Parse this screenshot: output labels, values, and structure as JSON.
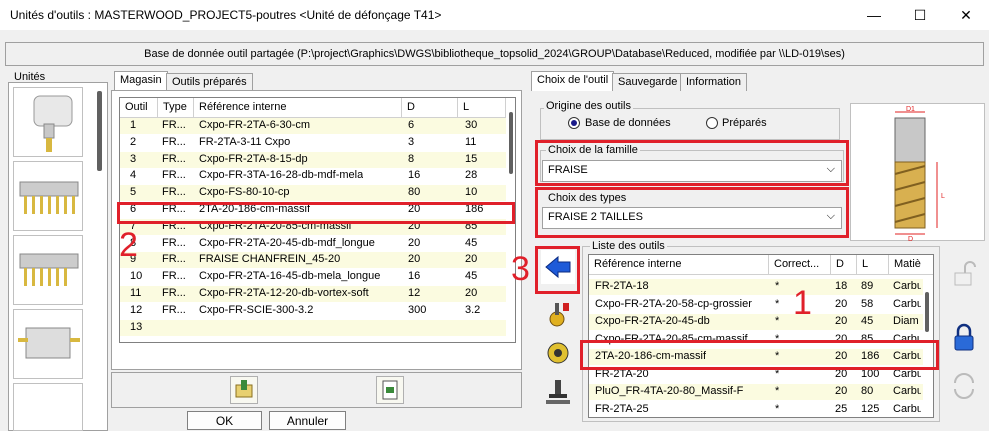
{
  "window": {
    "title": "Unités d'outils : MASTERWOOD_PROJECT5-poutres <Unité de défonçage  T41>",
    "minimize": "—",
    "maximize": "☐",
    "close": "✕"
  },
  "db_path": "Base de donnée outil partagée (P:\\project\\Graphics\\DWGS\\bibliotheque_topsolid_2024\\GROUP\\Database\\Reduced, modifiée par \\\\LD-019\\ses)",
  "units": {
    "label": "Unités",
    "items": [
      "unit-1",
      "unit-2",
      "unit-3",
      "unit-4",
      "unit-5"
    ]
  },
  "left_tabs": {
    "magasin": "Magasin",
    "prepared": "Outils préparés"
  },
  "tool_table": {
    "columns": [
      "Outil",
      "Type",
      "Référence interne",
      "D",
      "L"
    ],
    "rows": [
      {
        "outil": "1",
        "type": "FR...",
        "ref": "Cxpo-FR-2TA-6-30-cm",
        "d": "6",
        "l": "30"
      },
      {
        "outil": "2",
        "type": "FR...",
        "ref": "FR-2TA-3-11 Cxpo",
        "d": "3",
        "l": "11"
      },
      {
        "outil": "3",
        "type": "FR...",
        "ref": "Cxpo-FR-2TA-8-15-dp",
        "d": "8",
        "l": "15"
      },
      {
        "outil": "4",
        "type": "FR...",
        "ref": "Cxpo-FR-3TA-16-28-db-mdf-mela",
        "d": "16",
        "l": "28"
      },
      {
        "outil": "5",
        "type": "FR...",
        "ref": "Cxpo-FS-80-10-cp",
        "d": "80",
        "l": "10"
      },
      {
        "outil": "6",
        "type": "FR...",
        "ref": "2TA-20-186-cm-massif",
        "d": "20",
        "l": "186"
      },
      {
        "outil": "7",
        "type": "FR...",
        "ref": "Cxpo-FR-2TA-20-85-cm-massif",
        "d": "20",
        "l": "85"
      },
      {
        "outil": "8",
        "type": "FR...",
        "ref": "Cxpo-FR-2TA-20-45-db-mdf_longue",
        "d": "20",
        "l": "45"
      },
      {
        "outil": "9",
        "type": "FR...",
        "ref": "FRAISE CHANFREIN_45-20",
        "d": "20",
        "l": "20"
      },
      {
        "outil": "10",
        "type": "FR...",
        "ref": "Cxpo-FR-2TA-16-45-db-mela_longue",
        "d": "16",
        "l": "45"
      },
      {
        "outil": "11",
        "type": "FR...",
        "ref": "Cxpo-FR-2TA-12-20-db-vortex-soft",
        "d": "12",
        "l": "20"
      },
      {
        "outil": "12",
        "type": "FR...",
        "ref": "Cxpo-FR-SCIE-300-3.2",
        "d": "300",
        "l": "3.2"
      },
      {
        "outil": "13",
        "type": "",
        "ref": "",
        "d": "",
        "l": ""
      }
    ]
  },
  "buttons": {
    "ok": "OK",
    "cancel": "Annuler"
  },
  "right_tabs": {
    "choice": "Choix de l'outil",
    "backup": "Sauvegarde",
    "info": "Information"
  },
  "origin": {
    "label": "Origine des outils",
    "database": "Base de données",
    "prepared": "Préparés"
  },
  "family": {
    "label": "Choix de la famille",
    "value": "FRAISE"
  },
  "types": {
    "label": "Choix des types",
    "value": "FRAISE 2 TAILLES"
  },
  "list": {
    "label": "Liste des outils",
    "columns": [
      "Référence interne",
      "Correct...",
      "D",
      "L",
      "Matiè"
    ],
    "rows": [
      {
        "ref": "FR-2TA-18",
        "corr": "*",
        "d": "18",
        "l": "89",
        "mat": "Carbu"
      },
      {
        "ref": "Cxpo-FR-2TA-20-58-cp-grossier",
        "corr": "*",
        "d": "20",
        "l": "58",
        "mat": "Carbu"
      },
      {
        "ref": "Cxpo-FR-2TA-20-45-db",
        "corr": "*",
        "d": "20",
        "l": "45",
        "mat": "Diam"
      },
      {
        "ref": "Cxpo-FR-2TA-20-85-cm-massif",
        "corr": "*",
        "d": "20",
        "l": "85",
        "mat": "Carbu"
      },
      {
        "ref": "2TA-20-186-cm-massif",
        "corr": "*",
        "d": "20",
        "l": "186",
        "mat": "Carbu"
      },
      {
        "ref": "FR-2TA-20",
        "corr": "*",
        "d": "20",
        "l": "100",
        "mat": "Carbu"
      },
      {
        "ref": "PluO_FR-4TA-20-80_Massif-F",
        "corr": "*",
        "d": "20",
        "l": "80",
        "mat": "Carbu"
      },
      {
        "ref": "FR-2TA-25",
        "corr": "*",
        "d": "25",
        "l": "125",
        "mat": "Carbu"
      }
    ]
  },
  "annotations": {
    "one": "1",
    "two": "2",
    "three": "3"
  },
  "tool_drawing": {
    "d1": "D1",
    "d": "D",
    "l": "L"
  },
  "colors": {
    "highlight_red": "#e0202a",
    "arrow_blue": "#1e5ad8",
    "row_yellow": "#fbfbe0"
  }
}
